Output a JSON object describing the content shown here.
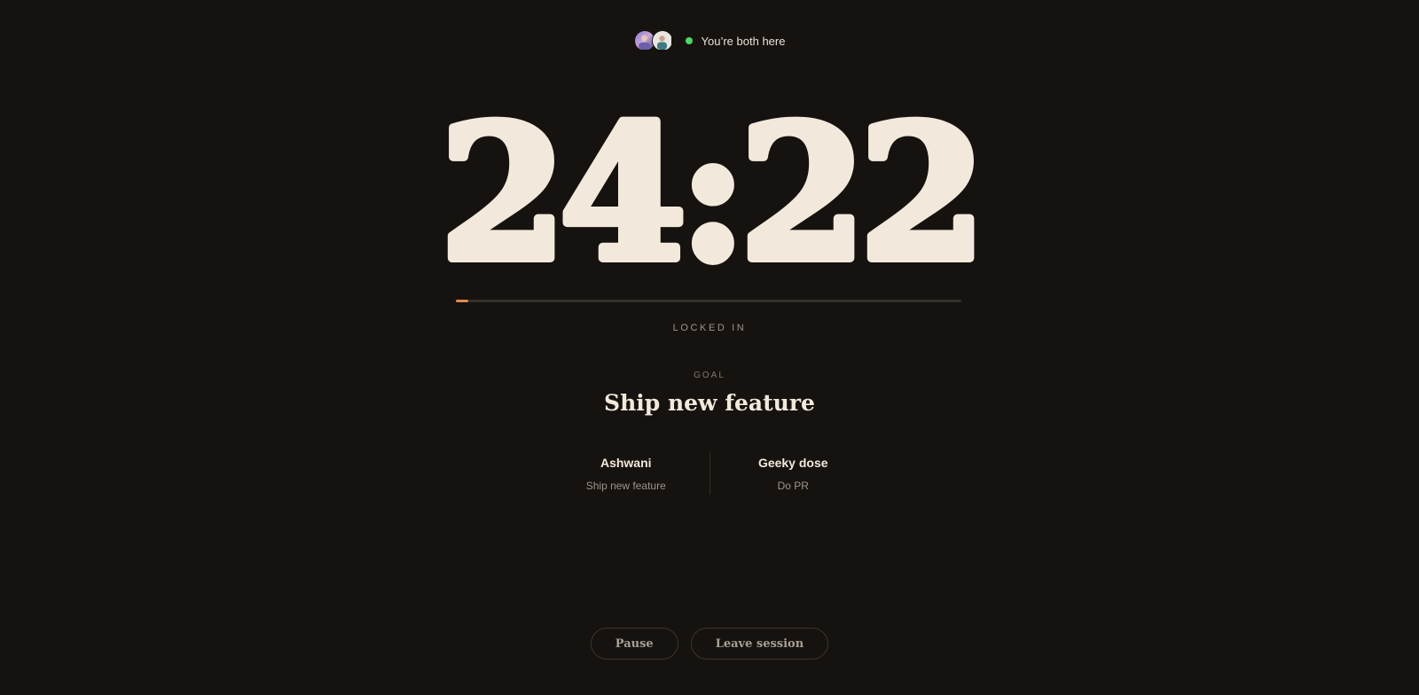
{
  "presence": {
    "text": "You’re both here",
    "status_color": "#4cd964",
    "avatars": [
      "user-avatar",
      "partner-avatar"
    ]
  },
  "timer": {
    "display": "24:22",
    "color": "#f2e9dc"
  },
  "progress": {
    "fraction": 0.025,
    "fill_color": "#e08a4c",
    "track_color": "#34302b"
  },
  "status": {
    "label": "LOCKED IN"
  },
  "goal": {
    "label": "GOAL",
    "title": "Ship new feature"
  },
  "participants": [
    {
      "name": "Ashwani",
      "goal": "Ship new feature"
    },
    {
      "name": "Geeky dose",
      "goal": "Do PR"
    }
  ],
  "actions": {
    "pause_label": "Pause",
    "leave_label": "Leave session"
  },
  "colors": {
    "background": "#16120f",
    "accent": "#e08a4c"
  }
}
